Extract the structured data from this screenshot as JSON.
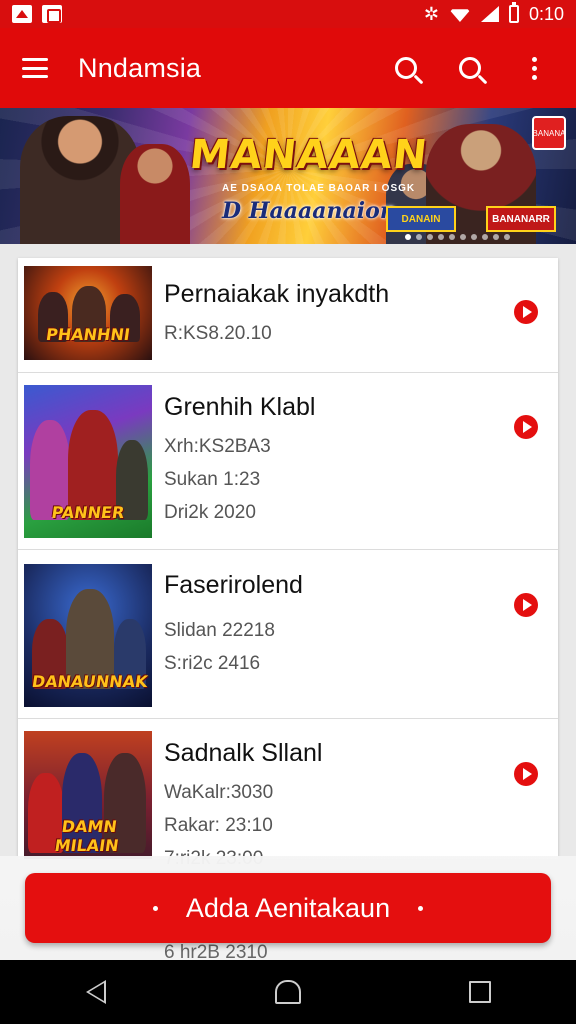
{
  "status_bar": {
    "time": "0:10",
    "icons": [
      "photo-icon",
      "notification-icon",
      "gear-icon",
      "wifi-icon",
      "signal-icon",
      "battery-icon"
    ]
  },
  "app_bar": {
    "title": "Nndamsia",
    "actions": [
      "search-icon",
      "search-icon",
      "more-vert-icon"
    ],
    "color": "#e00a0a"
  },
  "banner": {
    "title": "MANAAAN",
    "tagline": "AE DSAOA TOLAE BAOAR I OSGK",
    "subtitle": "D Haaaanaion",
    "badge_left": "DANAIN",
    "badge_right": "BANANARR",
    "corner_badge": "BANANA"
  },
  "list": {
    "items": [
      {
        "title": "Pernaiakak inyakdth",
        "meta": [
          "R:KS8.20.10"
        ],
        "thumb_logo": "PHANHNI"
      },
      {
        "title": "Grenhih Klabl",
        "meta": [
          "Xrh:KS2BA3",
          "Sukan 1:23",
          "Dri2k 2020"
        ],
        "thumb_logo": "PANNER"
      },
      {
        "title": "Faserirolend",
        "meta": [
          "Slidan 22218",
          "S:ri2c 2416"
        ],
        "thumb_logo": "DANAUNNAK"
      },
      {
        "title": "Sadnalk Sllanl",
        "meta": [
          "WaKalr:3030",
          "Rakar: 23:10",
          "7:ri2k 23:00"
        ],
        "thumb_logo": "DAMN MILAIN"
      }
    ],
    "peek_text": "6 hr2B 2310"
  },
  "cta": {
    "label": "Adda Aenitakaun",
    "color": "#e40f0f"
  },
  "nav_bar": {
    "buttons": [
      "back-icon",
      "home-icon",
      "recents-icon"
    ]
  }
}
